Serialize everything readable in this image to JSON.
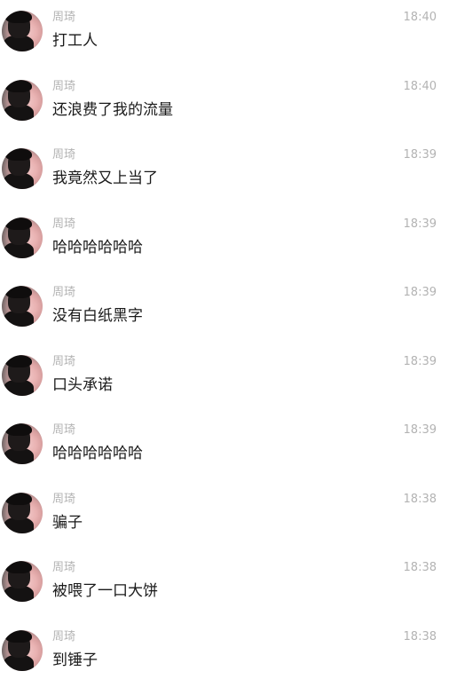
{
  "messages": [
    {
      "sender": "周琦",
      "time": "18:40",
      "text": "打工人"
    },
    {
      "sender": "周琦",
      "time": "18:40",
      "text": "还浪费了我的流量"
    },
    {
      "sender": "周琦",
      "time": "18:39",
      "text": "我竟然又上当了"
    },
    {
      "sender": "周琦",
      "time": "18:39",
      "text": "哈哈哈哈哈哈"
    },
    {
      "sender": "周琦",
      "time": "18:39",
      "text": "没有白纸黑字"
    },
    {
      "sender": "周琦",
      "time": "18:39",
      "text": "口头承诺"
    },
    {
      "sender": "周琦",
      "time": "18:39",
      "text": "哈哈哈哈哈哈"
    },
    {
      "sender": "周琦",
      "time": "18:38",
      "text": "骗子"
    },
    {
      "sender": "周琦",
      "time": "18:38",
      "text": "被喂了一口大饼"
    },
    {
      "sender": "周琦",
      "time": "18:38",
      "text": "到锤子"
    }
  ]
}
